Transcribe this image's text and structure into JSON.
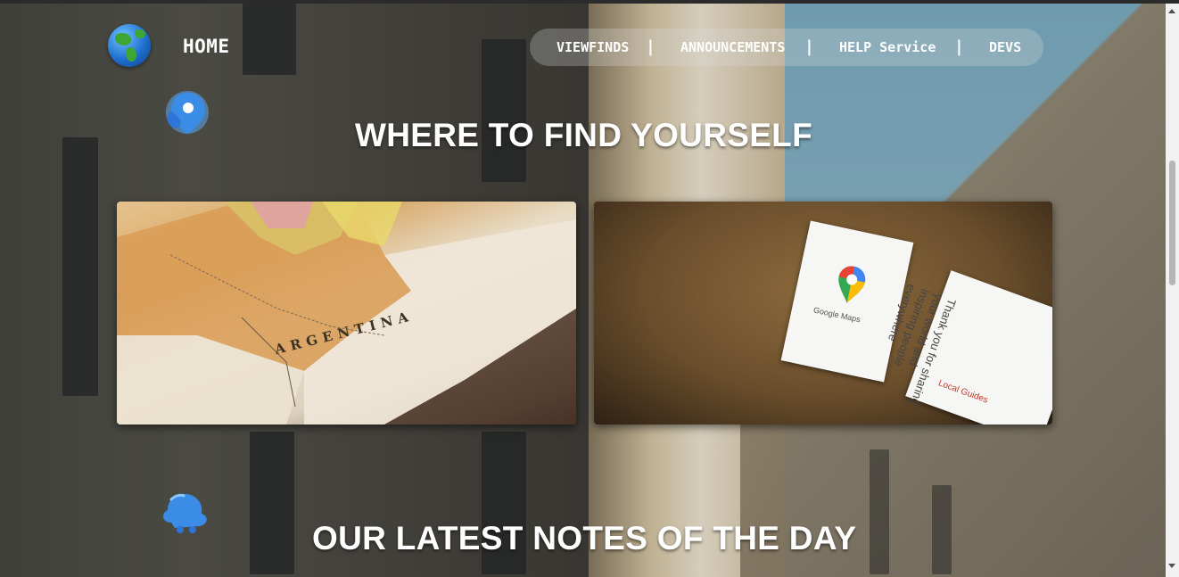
{
  "header": {
    "logo_icon": "globe-icon",
    "home_label": "HOME"
  },
  "nav": {
    "items": [
      {
        "label": "VIEWFINDS"
      },
      {
        "label": "ANNOUNCEMENTS"
      },
      {
        "label": "HELP Service"
      },
      {
        "label": "DEVS"
      }
    ],
    "separator": "|"
  },
  "sections": {
    "find": {
      "title": "WHERE TO FIND YOURSELF",
      "icon": "location-pin-icon"
    },
    "notes": {
      "title": "OUR LATEST NOTES OF THE DAY",
      "icon": "bell-blob-icon"
    }
  },
  "cards": [
    {
      "image": "vintage-map-argentina",
      "map_word": "ARGENTINA"
    },
    {
      "image": "google-maps-pin-card",
      "brand_text": "Google Maps",
      "note_text": "Thank you for sharing your world and inspiring people everywhere",
      "note_brand": "Local Guides"
    }
  ],
  "colors": {
    "nav_bg": "rgba(220,220,220,0.28)",
    "text": "#ffffff",
    "accent_blue": "#2b7de9"
  }
}
